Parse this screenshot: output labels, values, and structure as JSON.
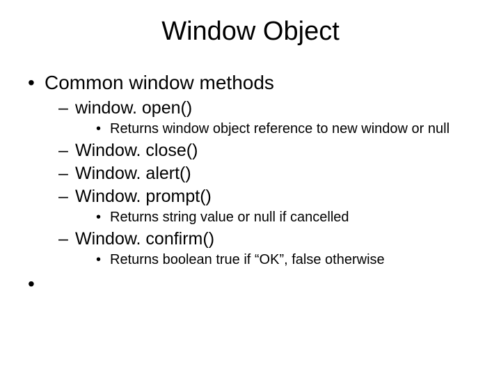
{
  "title": "Window Object",
  "bullets": {
    "l1_0": "Common window methods",
    "l2_0": "window. open()",
    "l3_0": "Returns window object reference to new window or null",
    "l2_1": "Window. close()",
    "l2_2": "Window. alert()",
    "l2_3": "Window. prompt()",
    "l3_1": "Returns string value or null if cancelled",
    "l2_4": "Window. confirm()",
    "l3_2": "Returns boolean true if “OK”, false otherwise"
  }
}
